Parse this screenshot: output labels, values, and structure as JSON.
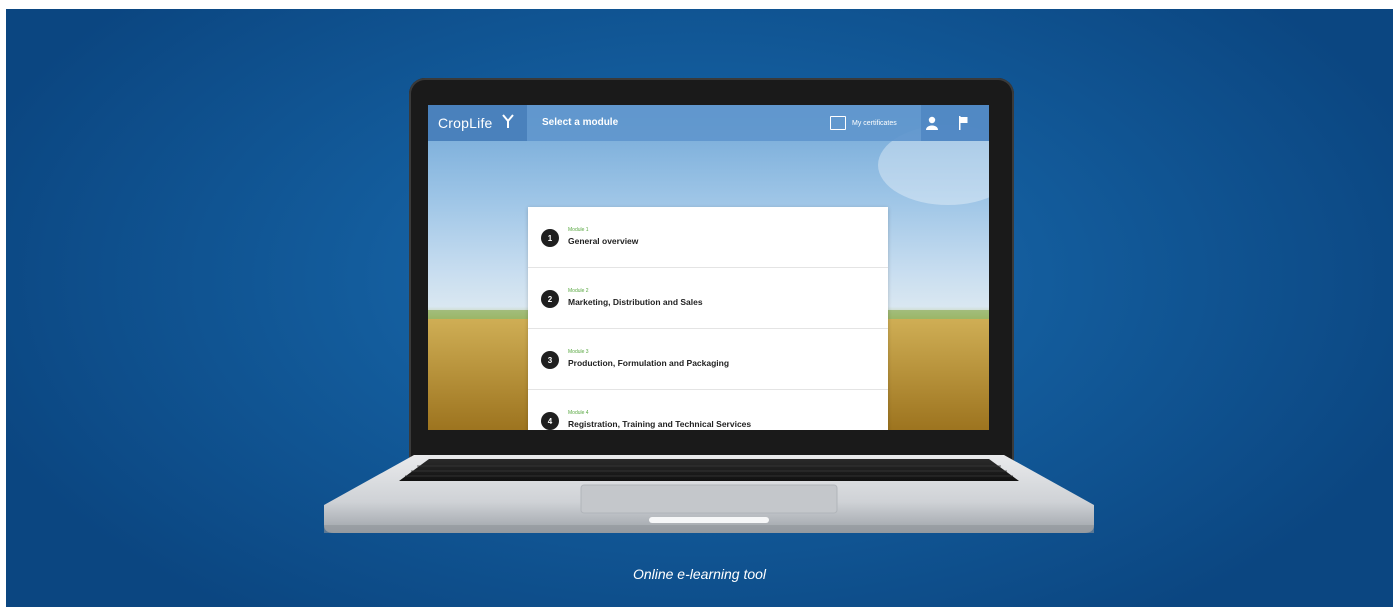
{
  "app": {
    "logo_text": "CropLife",
    "bar_title": "Select a module",
    "certificates_label": "My certificates"
  },
  "modules": [
    {
      "kicker": "Module 1",
      "number": "1",
      "title": "General overview"
    },
    {
      "kicker": "Module 2",
      "number": "2",
      "title": "Marketing, Distribution and Sales"
    },
    {
      "kicker": "Module 3",
      "number": "3",
      "title": "Production, Formulation and Packaging"
    },
    {
      "kicker": "Module 4",
      "number": "4",
      "title": "Registration, Training and Technical Services"
    }
  ],
  "caption": "Online e-learning tool",
  "icons": {
    "logo": "croplife-plant-icon",
    "certificates": "certificate-icon",
    "user": "user-icon",
    "flag": "flag-icon"
  },
  "colors": {
    "background": "#135c9c",
    "appbar": "#5f96cd",
    "module_kicker": "#5aa843",
    "module_badge": "#1f1f1f"
  }
}
